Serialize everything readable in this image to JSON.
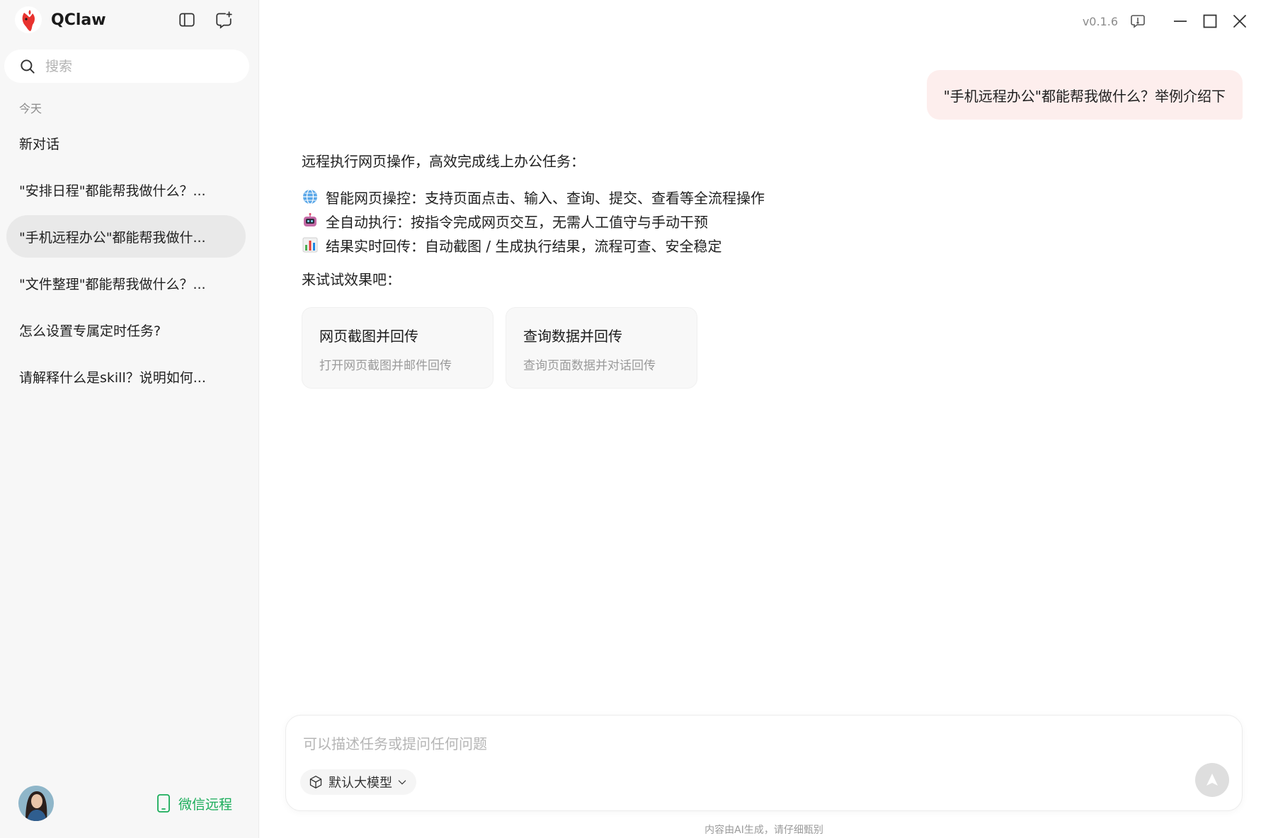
{
  "app": {
    "name": "QClaw",
    "version": "v0.1.6"
  },
  "sidebar": {
    "search_placeholder": "搜索",
    "section_label": "今天",
    "conversations": [
      {
        "label": "新对话"
      },
      {
        "label": "\"安排日程\"都能帮我做什么？..."
      },
      {
        "label": "\"手机远程办公\"都能帮我做什...",
        "active": true
      },
      {
        "label": "\"文件整理\"都能帮我做什么？..."
      },
      {
        "label": "怎么设置专属定时任务?"
      },
      {
        "label": "请解释什么是skill？说明如何..."
      }
    ],
    "wechat_remote_label": "微信远程"
  },
  "chat": {
    "user_message": "\"手机远程办公\"都能帮我做什么？举例介绍下",
    "answer_intro": "远程执行网页操作，高效完成线上办公任务：",
    "features": [
      {
        "icon": "globe-icon",
        "text": "智能网页操控：支持页面点击、输入、查询、提交、查看等全流程操作"
      },
      {
        "icon": "robot-icon",
        "text": "全自动执行：按指令完成网页交互，无需人工值守与手动干预"
      },
      {
        "icon": "bar-chart-icon",
        "text": "结果实时回传：自动截图 / 生成执行结果，流程可查、安全稳定"
      }
    ],
    "try_label": "来试试效果吧：",
    "cards": [
      {
        "title": "网页截图并回传",
        "desc": "打开网页截图并邮件回传"
      },
      {
        "title": "查询数据并回传",
        "desc": "查询页面数据并对话回传"
      }
    ]
  },
  "composer": {
    "placeholder": "可以描述任务或提问任何问题",
    "model_label": "默认大模型"
  },
  "footer": {
    "disclaimer": "内容由AI生成，请仔细甄别"
  },
  "colors": {
    "accent_green": "#1aad5a",
    "bubble_pink": "#fdeeed",
    "sidebar_bg": "#f7f7f7"
  }
}
